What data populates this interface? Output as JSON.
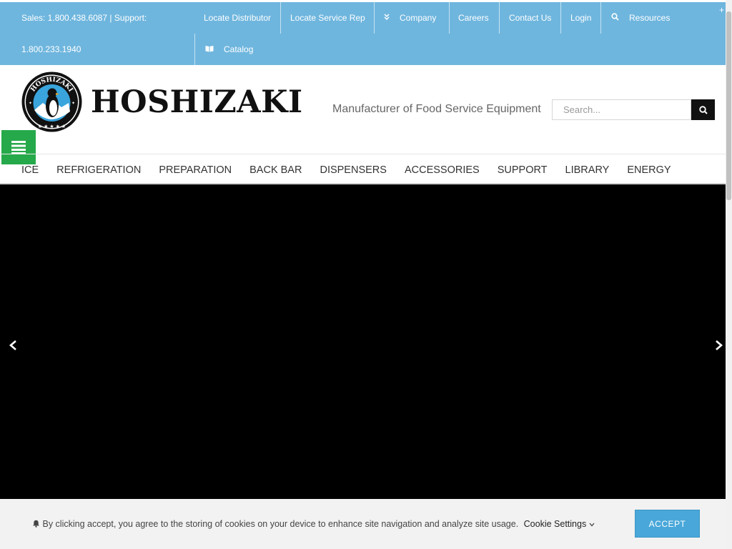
{
  "topbar": {
    "phones_line1": "Sales: 1.800.438.6087 | Support:",
    "phones_line2": "1.800.233.1940",
    "links": {
      "locate_distributor": "Locate Distributor",
      "locate_service_rep": "Locate Service Rep",
      "company": "Company",
      "careers": "Careers",
      "contact_us": "Contact Us",
      "login": "Login",
      "resources": "Resources",
      "catalog": "Catalog"
    }
  },
  "header": {
    "logo_text": "HOSHIZAKI",
    "badge_text": "HOSHIZAKI",
    "tagline": "Manufacturer of Food Service Equipment",
    "search_placeholder": "Search..."
  },
  "mainnav": [
    "ICE",
    "REFRIGERATION",
    "PREPARATION",
    "BACK BAR",
    "DISPENSERS",
    "ACCESSORIES",
    "SUPPORT",
    "LIBRARY",
    "ENERGY"
  ],
  "cookie": {
    "message": "By clicking accept, you agree to the storing of cookies on your device to enhance site navigation and analyze site usage.",
    "settings_label": "Cookie Settings",
    "accept_label": "ACCEPT"
  },
  "colors": {
    "topbar": "#6fb6de",
    "menu_toggle": "#26a94a",
    "accept_button": "#49a7d9",
    "hero": "#000000"
  }
}
